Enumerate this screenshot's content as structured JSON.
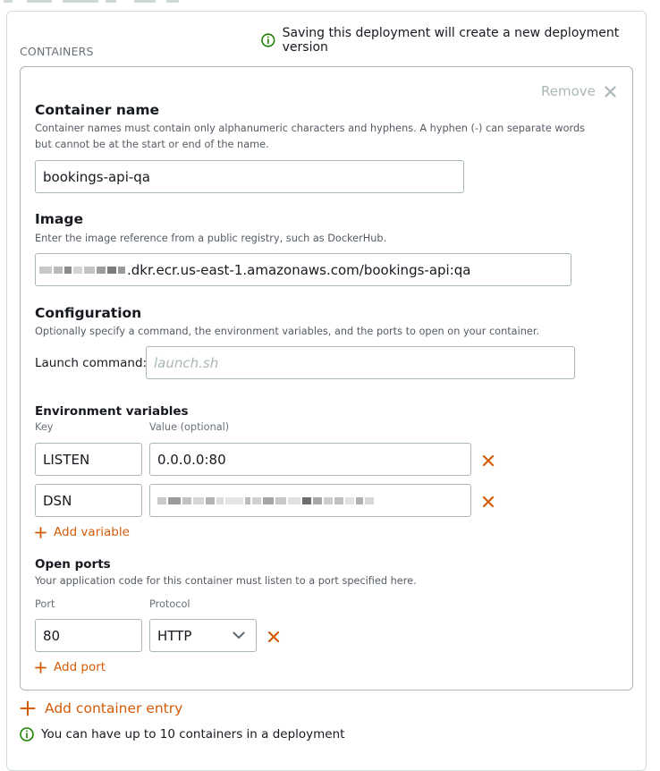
{
  "header": {
    "notice": "Saving this deployment will create a new deployment version",
    "section_label": "CONTAINERS"
  },
  "container": {
    "remove_label": "Remove",
    "name": {
      "heading": "Container name",
      "description_line1": "Container names must contain only alphanumeric characters and hyphens. A hyphen (-) can separate words",
      "description_line2": "but cannot be at the start or end of the name.",
      "value": "bookings-api-qa"
    },
    "image": {
      "heading": "Image",
      "description": "Enter the image reference from a public registry, such as DockerHub.",
      "value": ".dkr.ecr.us-east-1.amazonaws.com/bookings-api:qa"
    },
    "configuration": {
      "heading": "Configuration",
      "description": "Optionally specify a command, the environment variables, and the ports to open on your container.",
      "launch_label": "Launch command:",
      "launch_placeholder": "launch.sh"
    },
    "env": {
      "heading": "Environment variables",
      "key_label": "Key",
      "value_label": "Value (optional)",
      "rows": [
        {
          "key": "LISTEN",
          "value": "0.0.0.0:80"
        },
        {
          "key": "DSN",
          "value": ""
        }
      ],
      "add_label": "Add variable"
    },
    "ports": {
      "heading": "Open ports",
      "description": "Your application code for this container must listen to a port specified here.",
      "port_label": "Port",
      "protocol_label": "Protocol",
      "port_value": "80",
      "protocol_value": "HTTP",
      "add_label": "Add port"
    }
  },
  "footer": {
    "add_container_label": "Add container entry",
    "limit_notice": "You can have up to 10 containers in a deployment"
  },
  "colors": {
    "accent": "#d45b07",
    "success": "#1d8102",
    "border": "#aab7b8"
  }
}
